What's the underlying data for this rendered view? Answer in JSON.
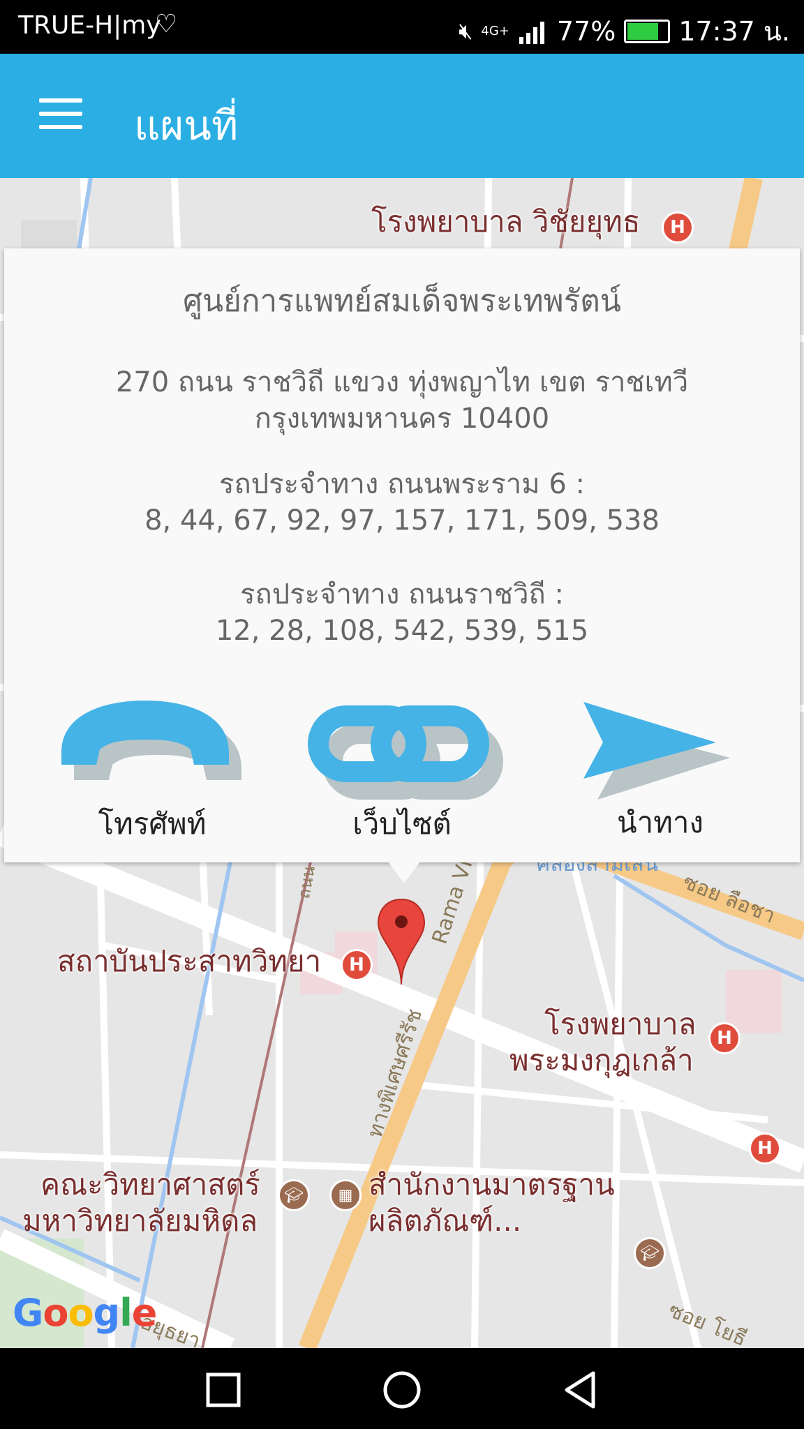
{
  "status_bar": {
    "carrier": "TRUE-H|my",
    "network": "4G+",
    "battery": "77%",
    "time": "17:37 น."
  },
  "app_bar": {
    "title": "แผนที่"
  },
  "map": {
    "labels": {
      "hospital_top": "โรงพยาบาล วิชัยยุทธ",
      "institute": "สถาบันประสาทวิทยา",
      "hospital_right_1": "โรงพยาบาล",
      "hospital_right_2": "พระมงกุฎเกล้า",
      "faculty_1": "คณะวิทยาศาสตร์",
      "faculty_2": "มหาวิทยาลัยมหิดล",
      "office_1": "สำนักงานมาตรฐาน",
      "office_2": "ผลิตภัณฑ์...",
      "road_rama": "Rama VI",
      "road_phitsanulok": "ทางพิเศษศรีรัช",
      "road_soi_right": "ซอย ลือชา",
      "road_soi_bottom": "ซอย โยธี",
      "road_bottom_left": "อยุธยา",
      "canal": "คลองสามเสน",
      "road_top_small": "ถนน"
    },
    "google_logo": "Google"
  },
  "info_window": {
    "name": "ศูนย์การแพทย์สมเด็จพระเทพรัตน์",
    "address_line1": "270 ถนน ราชวิถี แขวง ทุ่งพญาไท เขต ราชเทวี",
    "address_line2": "กรุงเทพมหานคร 10400",
    "bus_rama6_label": "รถประจำทาง ถนนพระราม 6 :",
    "bus_rama6_routes": "8, 44, 67, 92, 97, 157, 171, 509, 538",
    "bus_ratchawithi_label": "รถประจำทาง ถนนราชวิถี :",
    "bus_ratchawithi_routes": "12, 28, 108, 542, 539, 515",
    "actions": {
      "phone": "โทรศัพท์",
      "website": "เว็บไซต์",
      "directions": "นำทาง"
    }
  },
  "colors": {
    "app_bar": "#2aaee4",
    "icon_blue": "#45b3e6",
    "icon_shadow": "#b9c4c7"
  }
}
